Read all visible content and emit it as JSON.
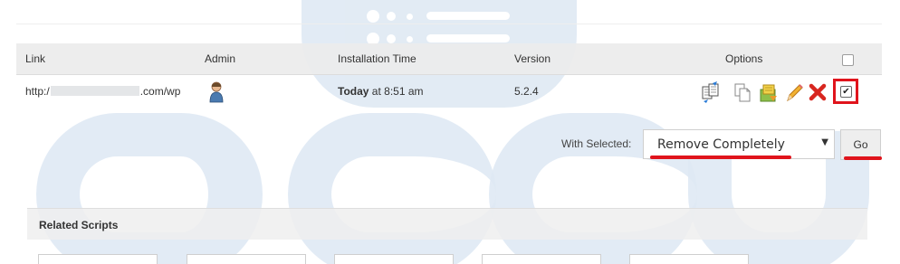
{
  "table": {
    "headers": {
      "link": "Link",
      "admin": "Admin",
      "installation_time": "Installation Time",
      "version": "Version",
      "options": "Options"
    },
    "row": {
      "link_prefix": "http:/",
      "link_suffix": ".com/wp",
      "install_day": "Today",
      "install_time": "at 8:51 am",
      "version": "5.2.4",
      "selected": true,
      "option_icons": [
        "clone-icon",
        "copy-icon",
        "backup-icon",
        "edit-pencil-icon",
        "remove-x-icon"
      ]
    }
  },
  "bulk_action": {
    "label": "With Selected:",
    "selected_option": "Remove Completely",
    "go_label": "Go"
  },
  "related_scripts": {
    "title": "Related Scripts"
  },
  "colors": {
    "highlight_red": "#e0141c",
    "watermark_blue": "#dde8f3",
    "header_bg": "#ececec"
  }
}
